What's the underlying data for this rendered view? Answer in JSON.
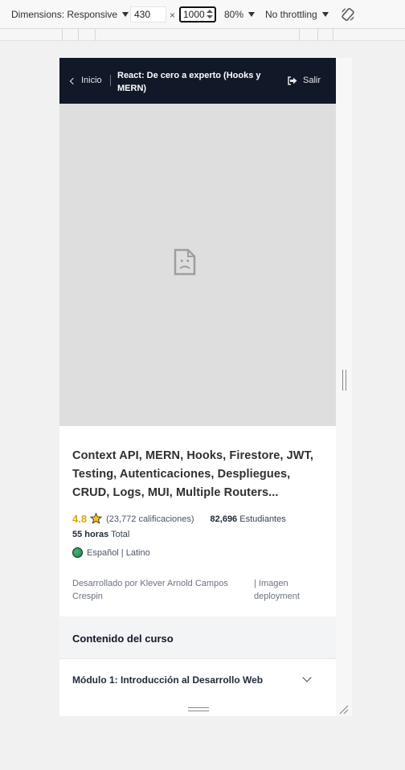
{
  "devtools": {
    "dimensions_label": "Dimensions: Responsive",
    "width_value": "430",
    "x_sign": "×",
    "height_value": "1000",
    "zoom": "80%",
    "throttling": "No throttling"
  },
  "header": {
    "back_label": "Inicio",
    "course_title": "React: De cero a experto (Hooks y MERN)",
    "exit_label": "Salir"
  },
  "video": {
    "icon": "broken-image-icon"
  },
  "course": {
    "headline": "Context API, MERN, Hooks, Firestore, JWT, Testing, Autenticaciones, Despliegues, CRUD, Logs, MUI, Multiple Routers...",
    "rating": "4.8",
    "ratings_count": "(23,772 calificaciones)",
    "students_count": "82,696",
    "students_label": "Estudiantes",
    "hours": "55 horas",
    "hours_label": "Total",
    "language": "Español | Latino",
    "author": "Desarrollado por Klever Arnold Campos Crespin",
    "tech_note": "| Imagen deployment"
  },
  "content": {
    "title": "Contenido del curso",
    "modules": [
      {
        "label": "Módulo 1: Introducción al Desarrollo Web"
      }
    ]
  },
  "colors": {
    "header_bg": "#111827",
    "rating": "#e0a400",
    "video_placeholder": "#dedede"
  }
}
